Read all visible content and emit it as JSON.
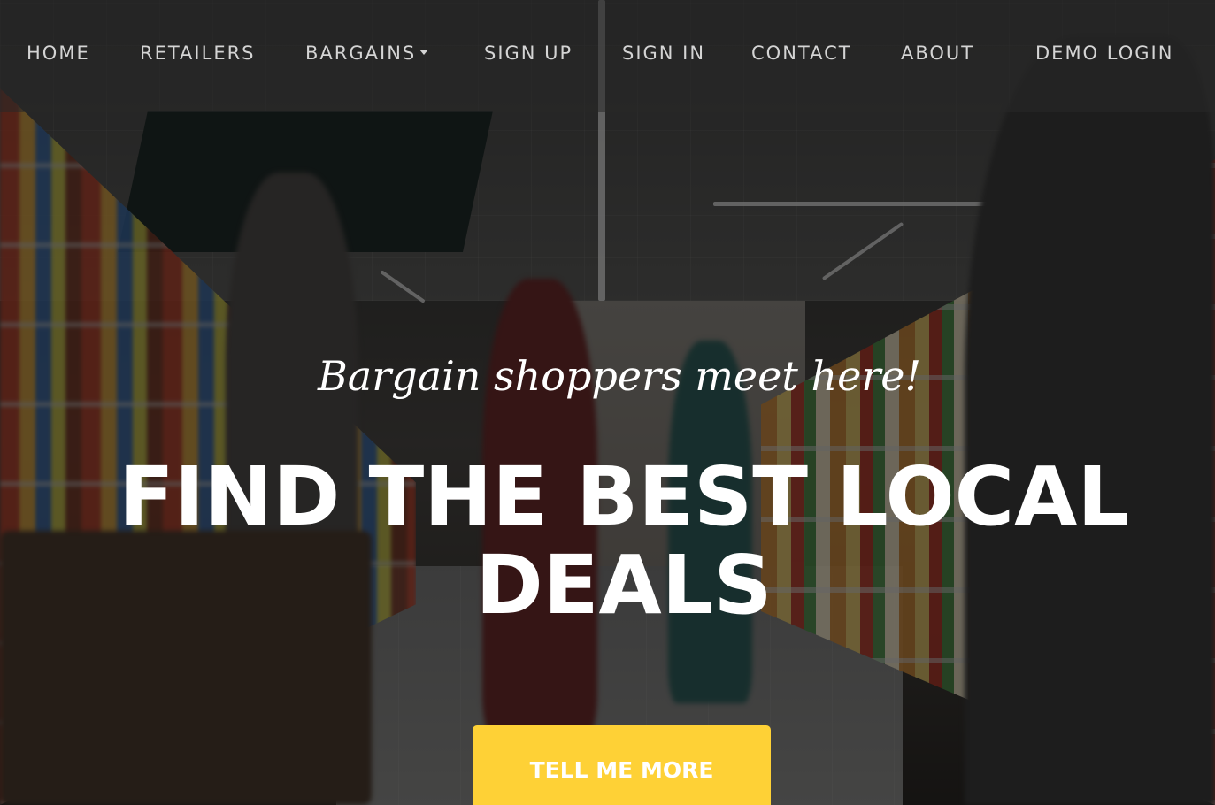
{
  "nav": {
    "items": [
      {
        "label": "HOME"
      },
      {
        "label": "RETAILERS"
      },
      {
        "label": "BARGAINS",
        "has_dropdown": true
      },
      {
        "label": "SIGN UP"
      },
      {
        "label": "SIGN IN"
      },
      {
        "label": "CONTACT"
      },
      {
        "label": "ABOUT"
      },
      {
        "label": "DEMO LOGIN"
      }
    ]
  },
  "hero": {
    "subheading": "Bargain shoppers meet here!",
    "heading": "FIND THE BEST LOCAL DEALS",
    "cta_label": "TELL ME MORE"
  },
  "colors": {
    "accent": "#fed136",
    "nav_text": "#d4d4d4",
    "hero_text": "#ffffff"
  }
}
